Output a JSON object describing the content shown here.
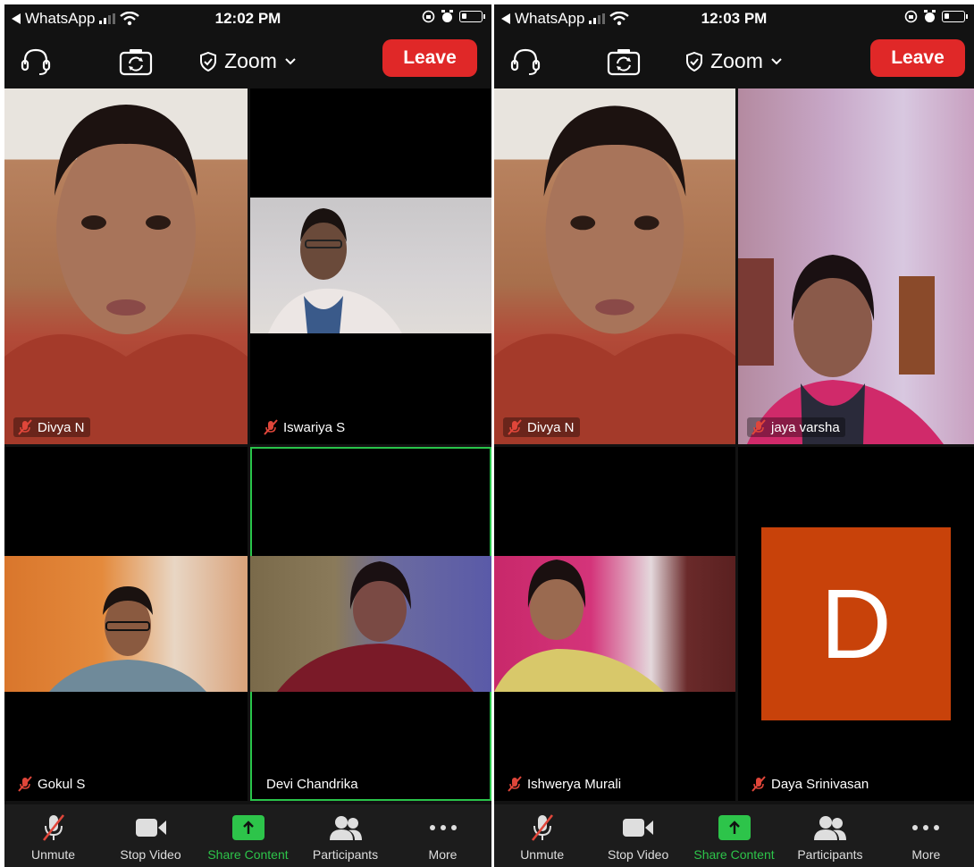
{
  "phones": [
    {
      "status": {
        "back_app": "WhatsApp",
        "time": "12:02 PM"
      },
      "header": {
        "title": "Zoom",
        "leave": "Leave"
      },
      "tiles": [
        {
          "name": "Divya N",
          "muted": true
        },
        {
          "name": "Iswariya S",
          "muted": true
        },
        {
          "name": "Gokul S",
          "muted": true
        },
        {
          "name": "Devi Chandrika",
          "muted": false,
          "active": true
        }
      ],
      "toolbar": [
        {
          "label": "Unmute",
          "icon": "mic-muted-icon"
        },
        {
          "label": "Stop Video",
          "icon": "video-camera-icon"
        },
        {
          "label": "Share Content",
          "icon": "share-arrow-icon"
        },
        {
          "label": "Participants",
          "icon": "participants-icon"
        },
        {
          "label": "More",
          "icon": "more-dots-icon"
        }
      ]
    },
    {
      "status": {
        "back_app": "WhatsApp",
        "time": "12:03 PM"
      },
      "header": {
        "title": "Zoom",
        "leave": "Leave"
      },
      "tiles": [
        {
          "name": "Divya N",
          "muted": true
        },
        {
          "name": "jaya varsha",
          "muted": true
        },
        {
          "name": "Ishwerya Murali",
          "muted": true
        },
        {
          "name": "Daya Srinivasan",
          "muted": true,
          "avatar": "D"
        }
      ],
      "toolbar": [
        {
          "label": "Unmute",
          "icon": "mic-muted-icon"
        },
        {
          "label": "Stop Video",
          "icon": "video-camera-icon"
        },
        {
          "label": "Share Content",
          "icon": "share-arrow-icon"
        },
        {
          "label": "Participants",
          "icon": "participants-icon"
        },
        {
          "label": "More",
          "icon": "more-dots-icon"
        }
      ]
    }
  ],
  "colors": {
    "leave": "#e02828",
    "share": "#2dc44a",
    "avatar": "#c8420a",
    "active_border": "#29c44a",
    "mute": "#e0463a"
  }
}
